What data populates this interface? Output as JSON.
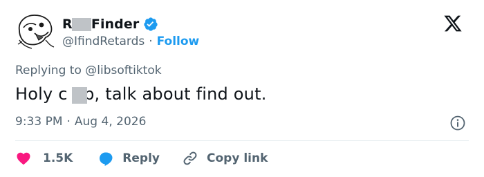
{
  "author": {
    "display_name": "R    d Finder",
    "handle": "@IfindRetards",
    "separator": "·",
    "follow_label": "Follow"
  },
  "reply_to": {
    "prefix": "Replying to",
    "mention": "@libsoftiktok"
  },
  "tweet": {
    "text": "Holy c   p, talk about find out."
  },
  "meta": {
    "time": "9:33 PM",
    "separator": "·",
    "date": "Aug 4, 2026"
  },
  "actions": {
    "like_count": "1.5K",
    "reply_label": "Reply",
    "copy_label": "Copy link"
  },
  "colors": {
    "accent": "#1d9bf0",
    "heart": "#f91880",
    "text": "#0f1419",
    "muted": "#536471"
  },
  "icons": [
    "verified-badge-icon",
    "x-logo-icon",
    "info-icon",
    "heart-icon",
    "reply-bubble-icon",
    "link-icon"
  ]
}
